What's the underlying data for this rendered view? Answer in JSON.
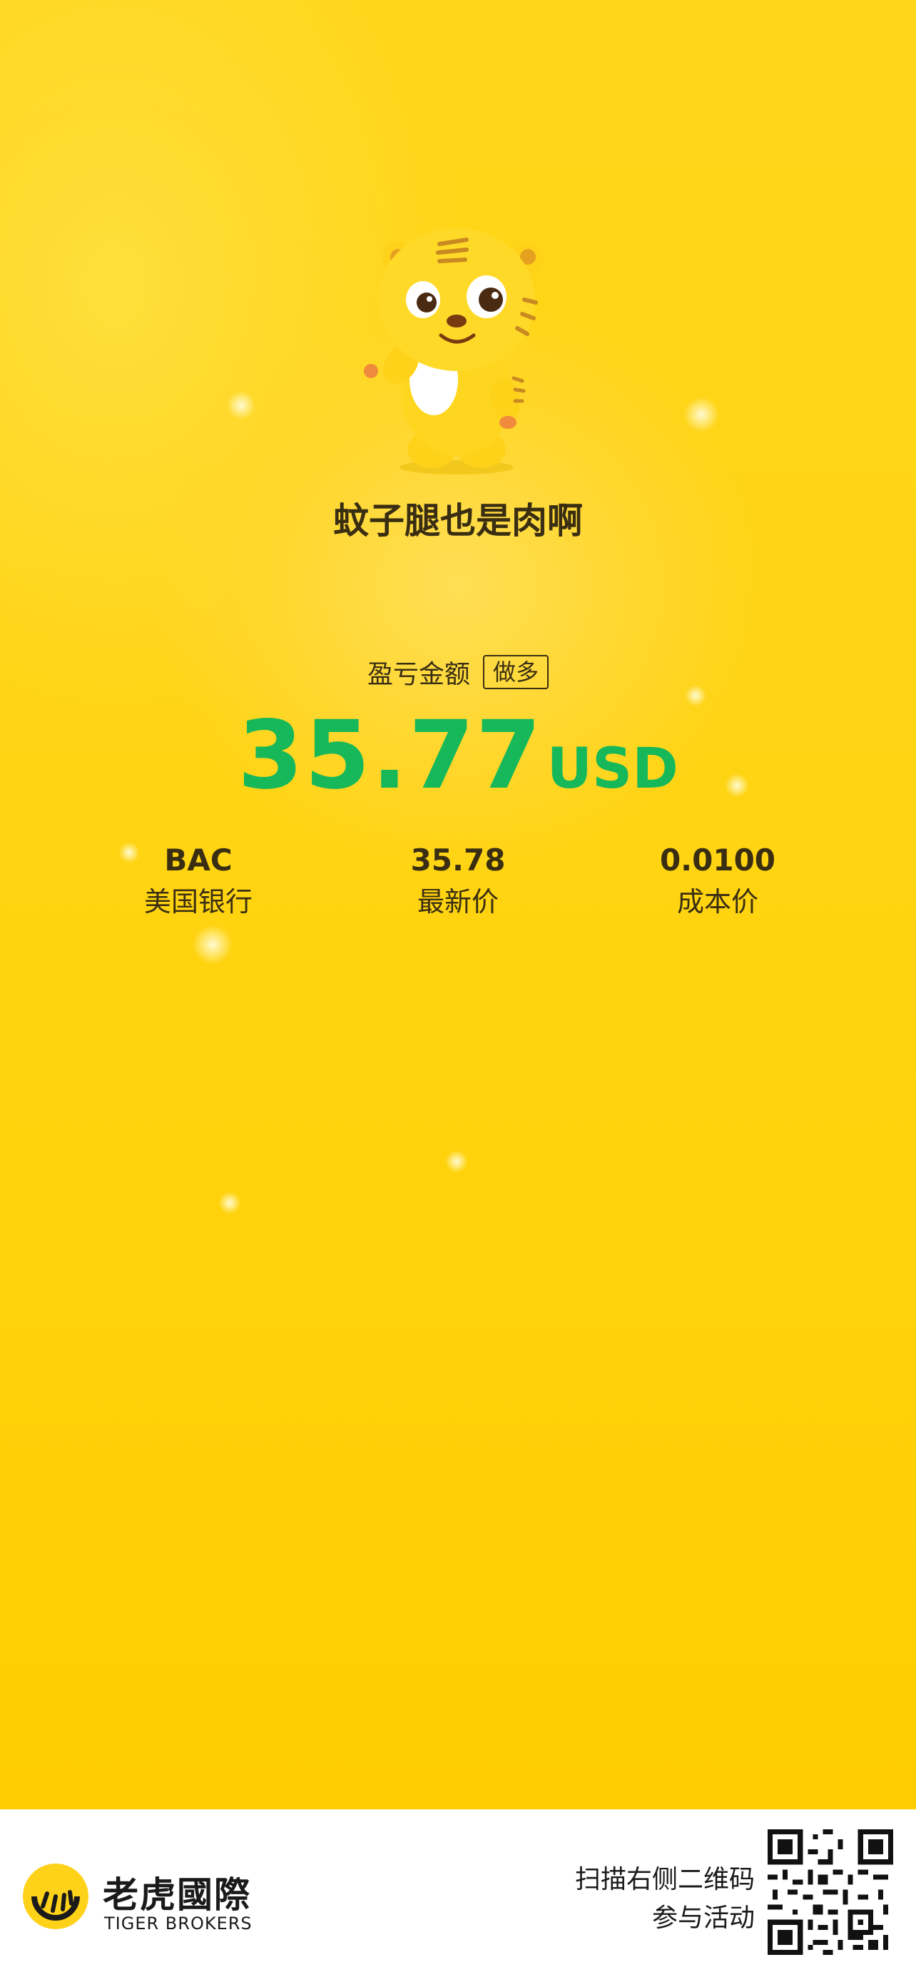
{
  "poster": {
    "nickname": "蚊子腿也是肉啊",
    "profit_label": "盈亏金额",
    "position_badge": "做多",
    "profit_amount": "35.77",
    "currency": "USD",
    "profit_color": "#16b85a",
    "stats": [
      {
        "value": "BAC",
        "label": "美国银行"
      },
      {
        "value": "35.78",
        "label": "最新价"
      },
      {
        "value": "0.0100",
        "label": "成本价"
      }
    ]
  },
  "footer": {
    "brand_cn": "老虎國際",
    "brand_en": "TIGER BROKERS",
    "cta_line1": "扫描右侧二维码",
    "cta_line2": "参与活动",
    "qr_icon": "qr-code-icon"
  },
  "colors": {
    "background": "#ffd414",
    "text": "#3a2e12"
  }
}
